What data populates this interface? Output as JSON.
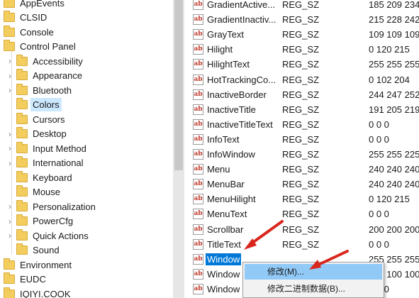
{
  "tree": {
    "items": [
      {
        "label": "AppEvents",
        "level": 0,
        "expander": ""
      },
      {
        "label": "CLSID",
        "level": 0,
        "expander": ""
      },
      {
        "label": "Console",
        "level": 0,
        "expander": ""
      },
      {
        "label": "Control Panel",
        "level": 0,
        "expander": ""
      },
      {
        "label": "Accessibility",
        "level": 1,
        "expander": "›"
      },
      {
        "label": "Appearance",
        "level": 1,
        "expander": "›"
      },
      {
        "label": "Bluetooth",
        "level": 1,
        "expander": "›"
      },
      {
        "label": "Colors",
        "level": 1,
        "expander": "",
        "selected": true
      },
      {
        "label": "Cursors",
        "level": 1,
        "expander": ""
      },
      {
        "label": "Desktop",
        "level": 1,
        "expander": "›"
      },
      {
        "label": "Input Method",
        "level": 1,
        "expander": "›"
      },
      {
        "label": "International",
        "level": 1,
        "expander": "›"
      },
      {
        "label": "Keyboard",
        "level": 1,
        "expander": ""
      },
      {
        "label": "Mouse",
        "level": 1,
        "expander": ""
      },
      {
        "label": "Personalization",
        "level": 1,
        "expander": "›"
      },
      {
        "label": "PowerCfg",
        "level": 1,
        "expander": "›"
      },
      {
        "label": "Quick Actions",
        "level": 1,
        "expander": "›"
      },
      {
        "label": "Sound",
        "level": 1,
        "expander": ""
      },
      {
        "label": "Environment",
        "level": 0,
        "expander": ""
      },
      {
        "label": "EUDC",
        "level": 0,
        "expander": ""
      },
      {
        "label": "IQIYI.COOK",
        "level": 0,
        "expander": ""
      }
    ]
  },
  "values": {
    "icon_text": "ab",
    "rows": [
      {
        "name": "GradientActive...",
        "type": "REG_SZ",
        "data": "185 209 234"
      },
      {
        "name": "GradientInactiv...",
        "type": "REG_SZ",
        "data": "215 228 242"
      },
      {
        "name": "GrayText",
        "type": "REG_SZ",
        "data": "109 109 109"
      },
      {
        "name": "Hilight",
        "type": "REG_SZ",
        "data": "0 120 215"
      },
      {
        "name": "HilightText",
        "type": "REG_SZ",
        "data": "255 255 255"
      },
      {
        "name": "HotTrackingCo...",
        "type": "REG_SZ",
        "data": "0 102 204"
      },
      {
        "name": "InactiveBorder",
        "type": "REG_SZ",
        "data": "244 247 252"
      },
      {
        "name": "InactiveTitle",
        "type": "REG_SZ",
        "data": "191 205 219"
      },
      {
        "name": "InactiveTitleText",
        "type": "REG_SZ",
        "data": "0 0 0"
      },
      {
        "name": "InfoText",
        "type": "REG_SZ",
        "data": "0 0 0"
      },
      {
        "name": "InfoWindow",
        "type": "REG_SZ",
        "data": "255 255 225"
      },
      {
        "name": "Menu",
        "type": "REG_SZ",
        "data": "240 240 240"
      },
      {
        "name": "MenuBar",
        "type": "REG_SZ",
        "data": "240 240 240"
      },
      {
        "name": "MenuHilight",
        "type": "REG_SZ",
        "data": "0 120 215"
      },
      {
        "name": "MenuText",
        "type": "REG_SZ",
        "data": "0 0 0"
      },
      {
        "name": "Scrollbar",
        "type": "REG_SZ",
        "data": "200 200 200"
      },
      {
        "name": "TitleText",
        "type": "REG_SZ",
        "data": "0 0 0"
      },
      {
        "name": "Window",
        "type": "",
        "data": "255 255 255",
        "selected": true
      },
      {
        "name": "Window",
        "type": "",
        "data": "100 100 100"
      },
      {
        "name": "Window",
        "type": "",
        "data": "0 0 0"
      }
    ]
  },
  "context_menu": {
    "items": [
      {
        "label": "修改(M)...",
        "hover": true
      },
      {
        "label": "修改二进制数据(B)..."
      }
    ]
  },
  "colors": {
    "selection": "#0078d7",
    "tree_selection": "#cce8ff",
    "menu_hover": "#91c9f7",
    "annotation_arrow": "#d9261c",
    "folder": "#f3cd5d"
  }
}
